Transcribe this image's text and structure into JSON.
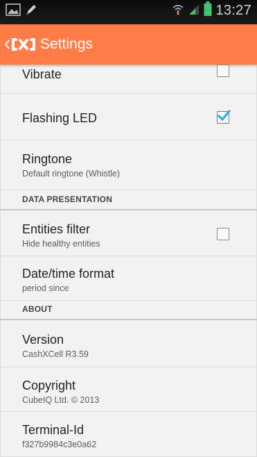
{
  "status_bar": {
    "time": "13:27",
    "left_icons": [
      "image-icon",
      "pencil-icon"
    ],
    "right_icons": [
      "wifi-icon",
      "signal-icon",
      "battery-icon"
    ]
  },
  "action_bar": {
    "title": "Settings",
    "background": "#ff7b47"
  },
  "settings": {
    "vibrate": {
      "label": "Vibrate",
      "checked": false
    },
    "flashing_led": {
      "label": "Flashing LED",
      "checked": true
    },
    "ringtone": {
      "label": "Ringtone",
      "summary": "Default ringtone (Whistle)"
    },
    "section_data": "DATA PRESENTATION",
    "entities_filter": {
      "label": "Entities filter",
      "summary": "Hide healthy entities",
      "checked": false
    },
    "datetime_format": {
      "label": "Date/time format",
      "summary": "period since"
    },
    "section_about": "ABOUT",
    "version": {
      "label": "Version",
      "summary": "CashXCell R3.59"
    },
    "copyright": {
      "label": "Copyright",
      "summary": "CubeIQ Ltd. © 2013"
    },
    "terminal_id": {
      "label": "Terminal-Id",
      "summary": "f327b9984c3e0a62"
    }
  },
  "colors": {
    "accent": "#ff7b47",
    "check": "#33b5e5"
  }
}
